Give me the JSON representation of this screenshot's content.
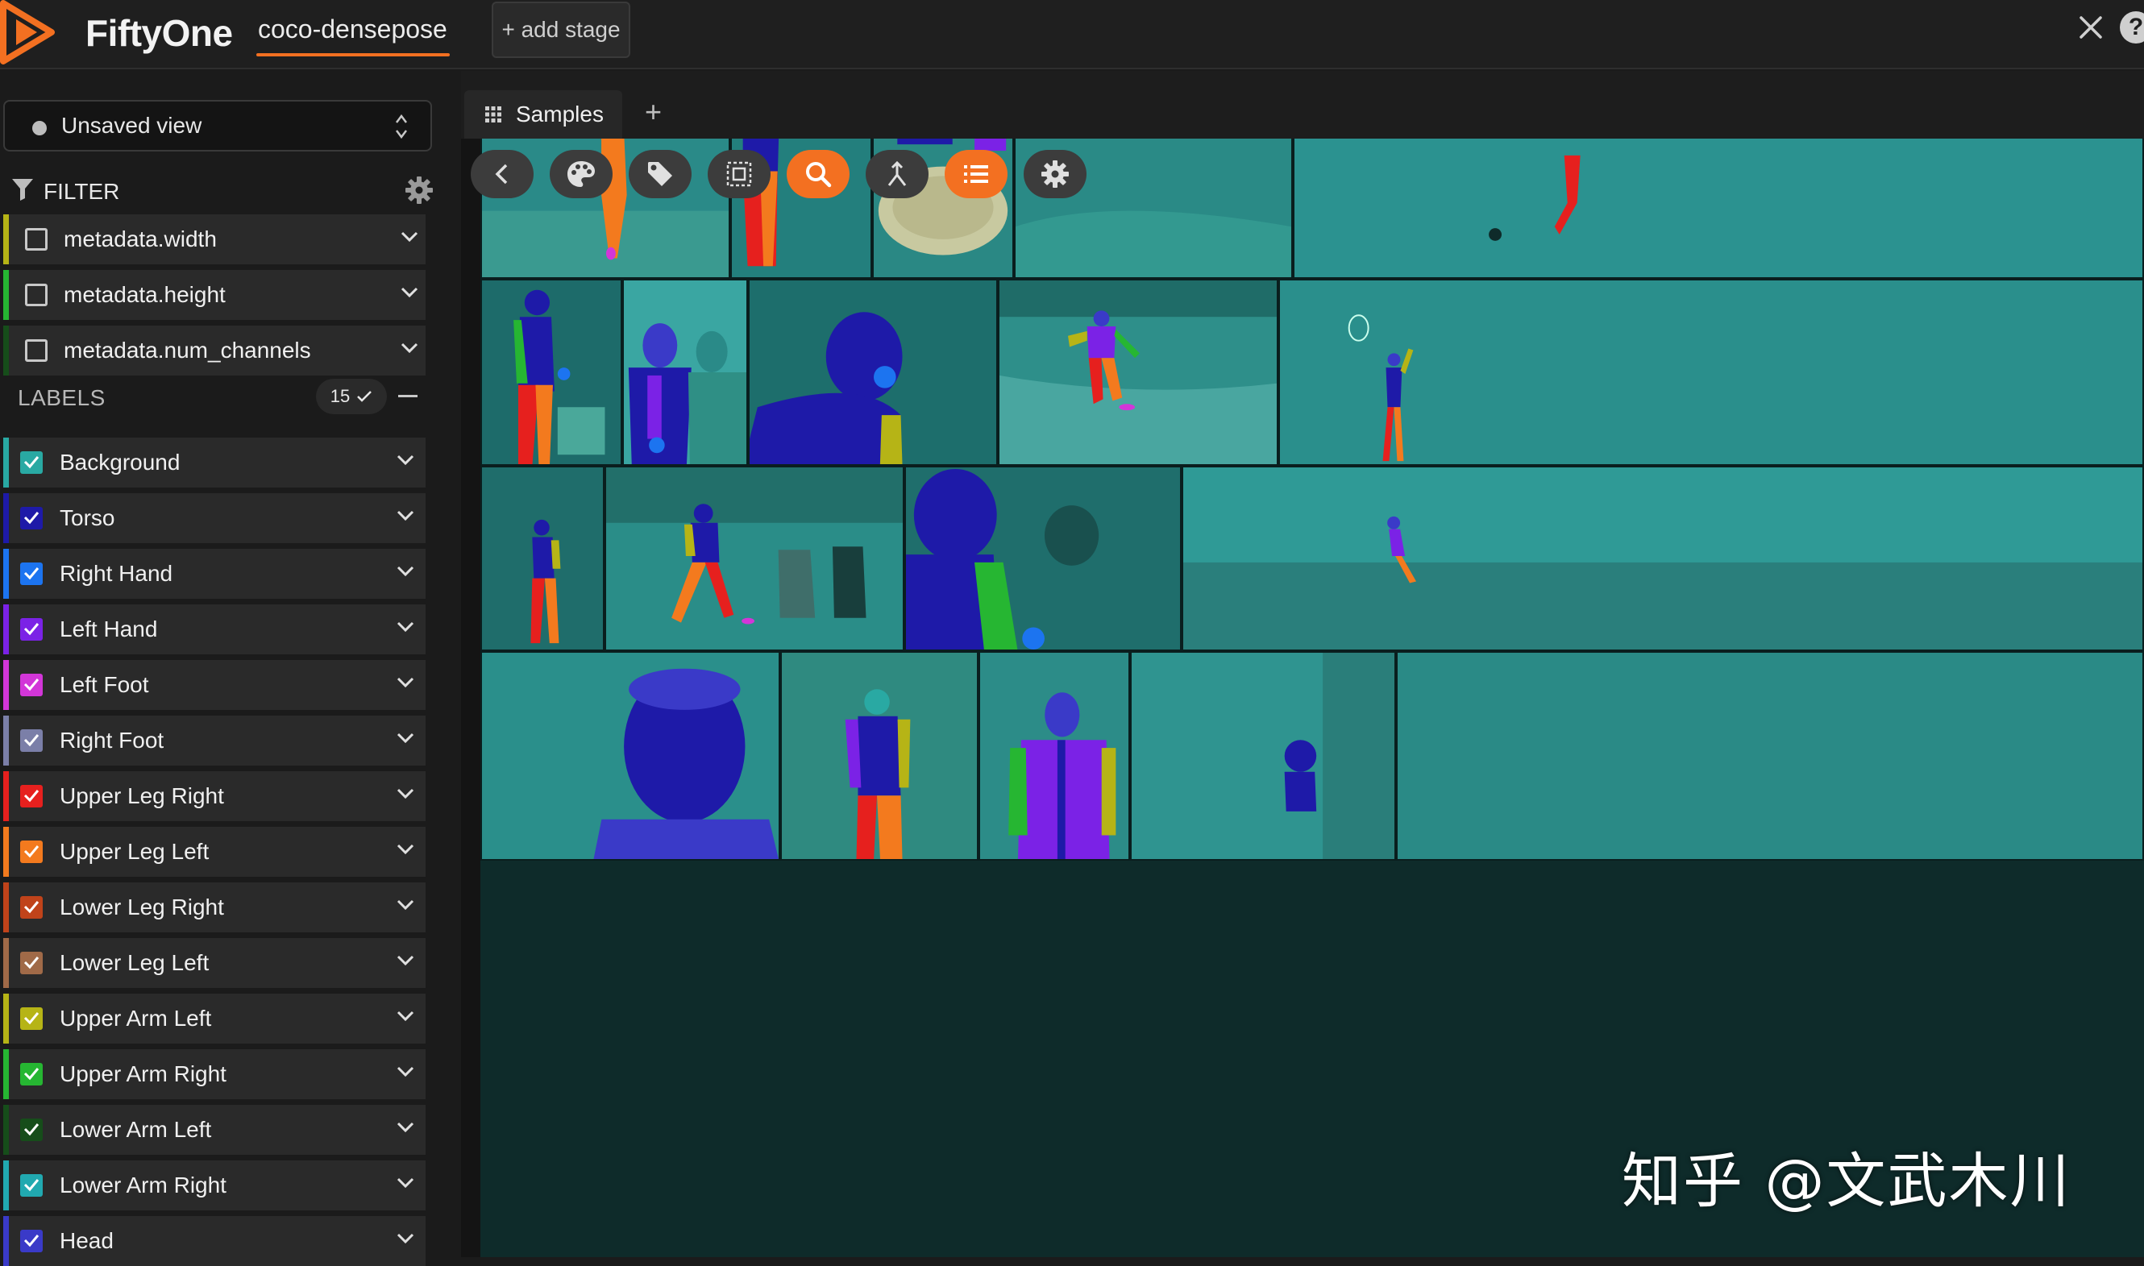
{
  "app": {
    "brand": "FiftyOne",
    "dataset": "coco-densepose",
    "add_stage": "+ add stage",
    "help": "?"
  },
  "sidebar": {
    "view_select": "Unsaved view",
    "filter_title": "FILTER",
    "fields": [
      {
        "label": "metadata.width"
      },
      {
        "label": "metadata.height"
      },
      {
        "label": "metadata.num_channels"
      }
    ],
    "labels_title": "LABELS",
    "labels_count": "15",
    "labels": [
      {
        "label": "Background",
        "color": "#29a9a3"
      },
      {
        "label": "Torso",
        "color": "#1e1aa8"
      },
      {
        "label": "Right Hand",
        "color": "#1c74f0"
      },
      {
        "label": "Left Hand",
        "color": "#7b22e6"
      },
      {
        "label": "Left Foot",
        "color": "#d236d8"
      },
      {
        "label": "Right Foot",
        "color": "#7b7fa8"
      },
      {
        "label": "Upper Leg Right",
        "color": "#e6201e"
      },
      {
        "label": "Upper Leg Left",
        "color": "#f37a1e"
      },
      {
        "label": "Lower Leg Right",
        "color": "#c0431a"
      },
      {
        "label": "Lower Leg Left",
        "color": "#a06a48"
      },
      {
        "label": "Upper Arm Left",
        "color": "#b6b416"
      },
      {
        "label": "Upper Arm Right",
        "color": "#26b632"
      },
      {
        "label": "Lower Arm Left",
        "color": "#164d1a"
      },
      {
        "label": "Lower Arm Right",
        "color": "#21a9b0"
      },
      {
        "label": "Head",
        "color": "#3a3ac8"
      }
    ]
  },
  "main": {
    "tab_label": "Samples",
    "tab_add": "+",
    "toolbar": [
      {
        "icon": "back-icon",
        "active": false
      },
      {
        "icon": "palette-icon",
        "active": false
      },
      {
        "icon": "tag-icon",
        "active": false
      },
      {
        "icon": "select-icon",
        "active": false
      },
      {
        "icon": "search-icon",
        "active": true
      },
      {
        "icon": "merge-icon",
        "active": false
      },
      {
        "icon": "list-icon",
        "active": true
      },
      {
        "icon": "gear-icon",
        "active": false
      }
    ]
  },
  "watermark": "知乎 @文武木川"
}
